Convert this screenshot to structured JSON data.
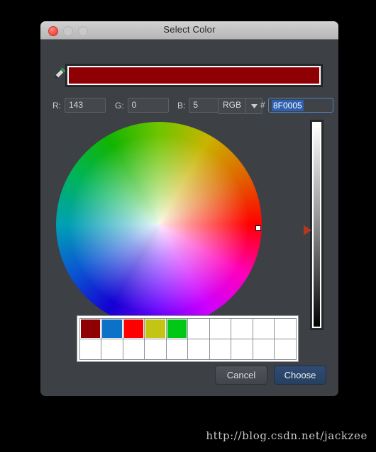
{
  "window": {
    "title": "Select Color",
    "traffic_lights": [
      {
        "name": "close",
        "color": "#f2463a"
      },
      {
        "name": "minimize",
        "color": "#c9c9c9"
      },
      {
        "name": "maximize",
        "color": "#c9c9c9"
      }
    ]
  },
  "preview": {
    "eyedropper_icon": "eyedropper-icon",
    "color": "#8F0005"
  },
  "inputs": {
    "r": {
      "label": "R:",
      "value": "143"
    },
    "g": {
      "label": "G:",
      "value": "0"
    },
    "b": {
      "label": "B:",
      "value": "5"
    },
    "mode": {
      "value": "RGB",
      "arrow_icon": "chevron-down-icon"
    },
    "hash": "#",
    "hex": {
      "value": "8F0005",
      "selected": true
    }
  },
  "wheel": {
    "marker_icon": "wheel-marker-icon"
  },
  "slider": {
    "marker_icon": "slider-marker-icon",
    "top_color": "#FFFFFF",
    "bottom_color": "#000000"
  },
  "palette": {
    "columns": 10,
    "rows": 2,
    "swatches": [
      "#8F0005",
      "#0B72C8",
      "#FF0000",
      "#C4C414",
      "#00C814",
      "",
      "",
      "",
      "",
      "",
      "",
      "",
      "",
      "",
      "",
      "",
      "",
      "",
      "",
      ""
    ]
  },
  "buttons": {
    "cancel": "Cancel",
    "choose": "Choose"
  },
  "watermark": "http://blog.csdn.net/jackzee"
}
